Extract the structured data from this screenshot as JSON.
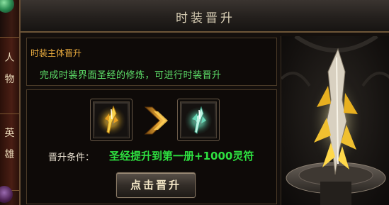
{
  "window": {
    "title": "时装晋升"
  },
  "side_tabs": [
    {
      "label_1": "人",
      "label_2": "物"
    },
    {
      "label_1": "英",
      "label_2": "雄"
    }
  ],
  "info": {
    "title": "时装主体晋升",
    "description": "完成时装界面圣经的修炼，可进行时装晋升"
  },
  "upgrade": {
    "condition_label": "晋升条件：",
    "condition_value": "圣经提升到第一册+1000灵符",
    "button_label": "点击晋升"
  },
  "colors": {
    "title_text": "#d9cfb6",
    "info_title": "#f0b040",
    "description": "#5ee06a",
    "condition_value": "#2ee040"
  },
  "icons": {
    "from_item": "golden-blade-icon",
    "arrow": "chevron-right-arrow-icon",
    "to_item": "jade-blade-icon"
  }
}
